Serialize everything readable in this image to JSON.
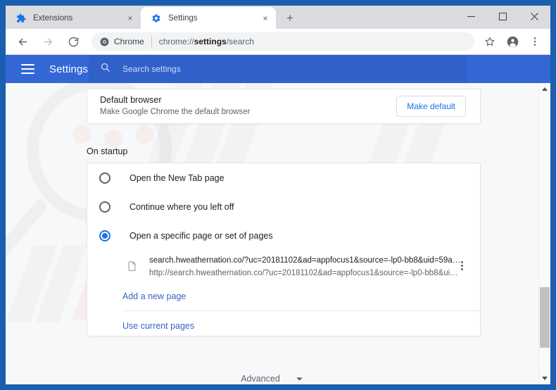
{
  "window": {
    "controls": {
      "minimize": "minimize-icon",
      "maximize": "maximize-icon",
      "close": "close-icon"
    }
  },
  "tabs": [
    {
      "title": "Extensions",
      "icon": "extension-puzzle-icon",
      "active": false,
      "close": "×"
    },
    {
      "title": "Settings",
      "icon": "settings-gear-icon",
      "active": true,
      "close": "×"
    }
  ],
  "new_tab_label": "+",
  "toolbar": {
    "back": "back-arrow-icon",
    "forward": "forward-arrow-icon",
    "reload": "reload-icon",
    "chrome_chip_label": "Chrome",
    "url_prefix": "chrome://",
    "url_bold": "settings",
    "url_suffix": "/search",
    "bookmark": "star-icon",
    "profile": "profile-avatar-icon",
    "menu": "three-dot-menu-icon"
  },
  "settings_header": {
    "title": "Settings",
    "menu_icon": "hamburger-menu-icon",
    "search_icon": "search-icon",
    "search_placeholder": "Search settings"
  },
  "default_browser": {
    "title": "Default browser",
    "subtitle": "Make Google Chrome the default browser",
    "button_label": "Make default"
  },
  "on_startup": {
    "section_label": "On startup",
    "options": [
      {
        "label": "Open the New Tab page",
        "selected": false
      },
      {
        "label": "Continue where you left off",
        "selected": false
      },
      {
        "label": "Open a specific page or set of pages",
        "selected": true
      }
    ],
    "startup_page": {
      "icon": "page-document-icon",
      "title": "search.hweathernation.co/?uc=20181102&ad=appfocus1&source=-lp0-bb8&uid=59a…",
      "url": "http://search.hweathernation.co/?uc=20181102&ad=appfocus1&source=-lp0-bb8&ui…",
      "menu_icon": "three-dot-menu-icon"
    },
    "add_new_page_label": "Add a new page",
    "use_current_pages_label": "Use current pages"
  },
  "advanced": {
    "label": "Advanced",
    "chevron_icon": "chevron-down-icon"
  },
  "scrollbar": {
    "up_icon": "scroll-up-arrow-icon",
    "down_icon": "scroll-down-arrow-icon"
  },
  "colors": {
    "window_frame": "#1a5fad",
    "settings_header": "#3367d6",
    "accent_blue": "#1a73e8",
    "link_blue": "#3b63c4",
    "tab_strip": "#dadce0",
    "body_bg": "#f7f8f9"
  }
}
